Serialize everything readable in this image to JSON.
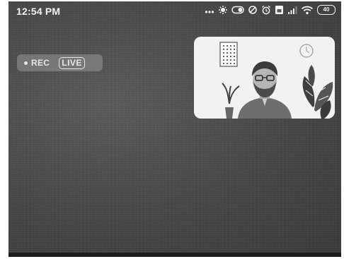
{
  "status_bar": {
    "time": "12:54 PM",
    "battery_level": "40",
    "icons": [
      "more-dots-icon",
      "notification-icon",
      "toggle-icon",
      "data-saver-icon",
      "alarm-icon",
      "sim-icon",
      "signal-icon",
      "wifi-icon",
      "battery-icon"
    ]
  },
  "recording": {
    "rec_label": "REC",
    "live_label": "LIVE"
  },
  "camera_preview": {
    "content": "selfie-camera-preview"
  }
}
